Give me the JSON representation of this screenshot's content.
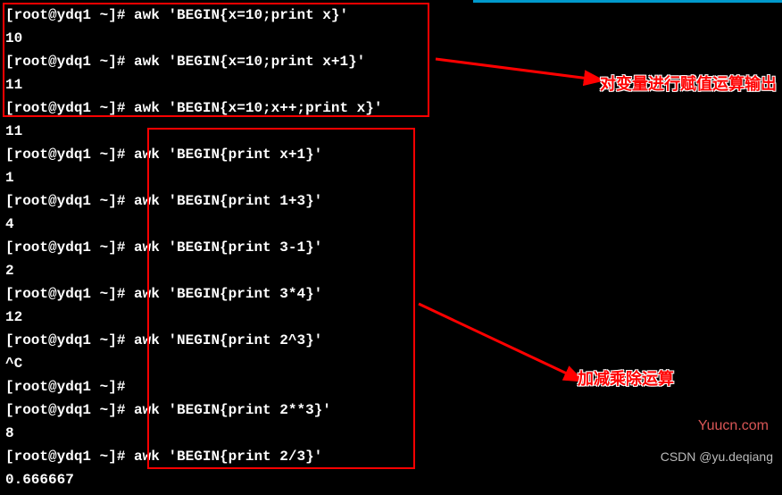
{
  "terminal": {
    "lines": [
      {
        "type": "cmd",
        "prompt": "[root@ydq1 ~]# ",
        "command": "awk 'BEGIN{x=10;print x}'"
      },
      {
        "type": "out",
        "text": "10"
      },
      {
        "type": "cmd",
        "prompt": "[root@ydq1 ~]# ",
        "command": "awk 'BEGIN{x=10;print x+1}'"
      },
      {
        "type": "out",
        "text": "11"
      },
      {
        "type": "cmd",
        "prompt": "[root@ydq1 ~]# ",
        "command": "awk 'BEGIN{x=10;x++;print x}'"
      },
      {
        "type": "out",
        "text": "11"
      },
      {
        "type": "cmd",
        "prompt": "[root@ydq1 ~]# ",
        "command": "awk 'BEGIN{print x+1}'"
      },
      {
        "type": "out",
        "text": "1"
      },
      {
        "type": "cmd",
        "prompt": "[root@ydq1 ~]# ",
        "command": "awk 'BEGIN{print 1+3}'"
      },
      {
        "type": "out",
        "text": "4"
      },
      {
        "type": "cmd",
        "prompt": "[root@ydq1 ~]# ",
        "command": "awk 'BEGIN{print 3-1}'"
      },
      {
        "type": "out",
        "text": "2"
      },
      {
        "type": "cmd",
        "prompt": "[root@ydq1 ~]# ",
        "command": "awk 'BEGIN{print 3*4}'"
      },
      {
        "type": "out",
        "text": "12"
      },
      {
        "type": "cmd",
        "prompt": "[root@ydq1 ~]# ",
        "command": "awk 'NEGIN{print 2^3}'"
      },
      {
        "type": "out",
        "text": "^C"
      },
      {
        "type": "cmd",
        "prompt": "[root@ydq1 ~]# ",
        "command": ""
      },
      {
        "type": "cmd",
        "prompt": "[root@ydq1 ~]# ",
        "command": "awk 'BEGIN{print 2**3}'"
      },
      {
        "type": "out",
        "text": "8"
      },
      {
        "type": "cmd",
        "prompt": "[root@ydq1 ~]# ",
        "command": "awk 'BEGIN{print 2/3}'"
      },
      {
        "type": "out",
        "text": "0.666667"
      }
    ]
  },
  "annotations": {
    "label1": "对变量进行赋值运算输出",
    "label2": "加减乘除运算"
  },
  "watermarks": {
    "site": "Yuucn.com",
    "author": "CSDN @yu.deqiang"
  }
}
